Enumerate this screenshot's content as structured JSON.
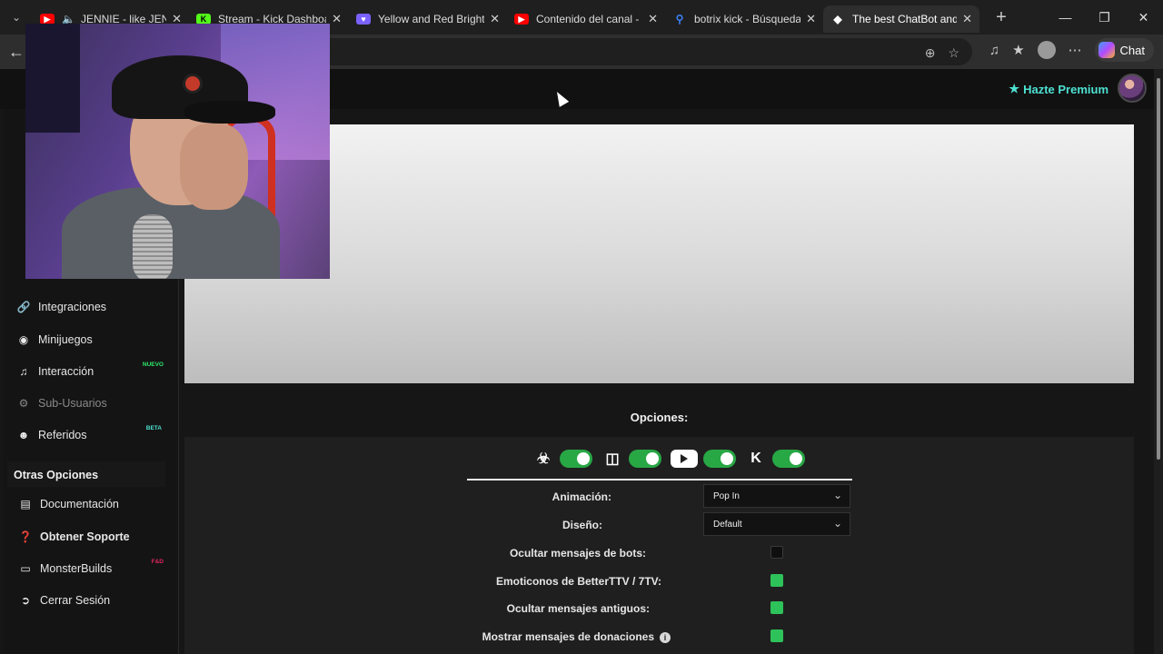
{
  "browser": {
    "tabs": [
      {
        "label": "JENNIE - like JENNIE",
        "color": "#ff0000",
        "icon": "youtube-icon",
        "audio": true,
        "active": false
      },
      {
        "label": "Stream - Kick Dashboard",
        "color": "#53fc18",
        "icon": "kick-icon",
        "active": false
      },
      {
        "label": "Yellow and Red Bright a",
        "color": "#7b61ff",
        "icon": "heart-shield-icon",
        "active": false
      },
      {
        "label": "Contenido del canal - Yo",
        "color": "#ff0000",
        "icon": "youtube-studio-icon",
        "active": false
      },
      {
        "label": "botrix kick - Búsqueda",
        "color": "#3b82f6",
        "icon": "search-icon",
        "active": false
      },
      {
        "label": "The best ChatBot and W",
        "color": "#ffffff",
        "icon": "botrix-icon",
        "active": true
      }
    ],
    "copilot_label": "Chat"
  },
  "topnav": {
    "premium_label": "Hazte Premium"
  },
  "sidebar": {
    "items": [
      {
        "label": "Integraciones",
        "icon": "link-icon",
        "state": "normal",
        "badge": ""
      },
      {
        "label": "Minijuegos",
        "icon": "gamepad-icon",
        "state": "normal",
        "badge": ""
      },
      {
        "label": "Interacción",
        "icon": "music-note-icon",
        "state": "normal",
        "badge": "NUEVO",
        "badge_color": "#2ee86b"
      },
      {
        "label": "Sub-Usuarios",
        "icon": "users-gear-icon",
        "state": "dim",
        "badge": ""
      },
      {
        "label": "Referidos",
        "icon": "users-icon",
        "state": "normal",
        "badge": "BETA",
        "badge_color": "#4de1d2"
      }
    ],
    "section_title": "Otras Opciones",
    "other_items": [
      {
        "label": "Documentación",
        "icon": "book-icon",
        "bold": false,
        "badge": ""
      },
      {
        "label": "Obtener Soporte",
        "icon": "question-circle-icon",
        "bold": true,
        "badge": ""
      },
      {
        "label": "MonsterBuilds",
        "icon": "laptop-icon",
        "bold": false,
        "badge": "F&D",
        "badge_color": "#e0245e"
      },
      {
        "label": "Cerrar Sesión",
        "icon": "sign-out-icon",
        "bold": false,
        "badge": ""
      }
    ]
  },
  "options": {
    "title": "Opciones:",
    "platforms": [
      {
        "name": "botrix",
        "enabled": true
      },
      {
        "name": "twitch",
        "enabled": true
      },
      {
        "name": "youtube",
        "enabled": true
      },
      {
        "name": "kick",
        "enabled": true
      }
    ],
    "animation_label": "Animación:",
    "animation_value": "Pop In",
    "design_label": "Diseño:",
    "design_value": "Default",
    "checks": [
      {
        "label": "Ocultar mensajes de bots:",
        "checked": false,
        "info": false
      },
      {
        "label": "Emoticonos de BetterTTV / 7TV:",
        "checked": true,
        "info": false
      },
      {
        "label": "Ocultar mensajes antiguos:",
        "checked": true,
        "info": false
      },
      {
        "label": "Mostrar mensajes de donaciones",
        "checked": true,
        "info": true
      }
    ]
  }
}
